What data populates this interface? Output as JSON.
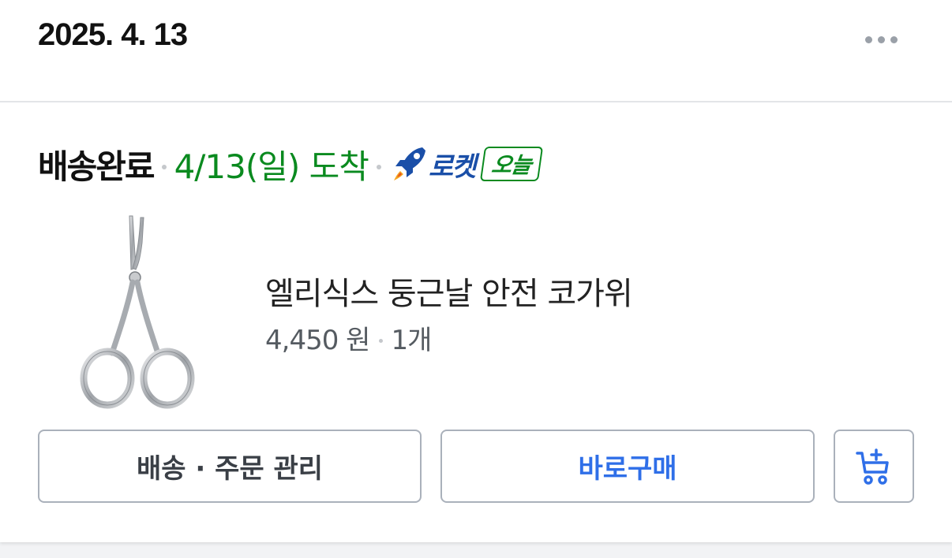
{
  "order": {
    "date": "2025. 4. 13",
    "status": "배송완료",
    "arrival": "4/13(일) 도착",
    "delivery_badge": "로켓",
    "today_badge": "오늘"
  },
  "product": {
    "name": "엘리식스 둥근날 안전 코가위",
    "price": "4,450 원",
    "quantity": "1개"
  },
  "buttons": {
    "manage": "배송 · 주문 관리",
    "buy_again": "바로구매"
  },
  "colors": {
    "arrival_green": "#0a8a1f",
    "rocket_blue": "#1a4fa8",
    "buy_blue": "#2f6fe8"
  },
  "icons": {
    "more": "more-dots-icon",
    "rocket": "rocket-icon",
    "cart": "add-to-cart-icon"
  }
}
